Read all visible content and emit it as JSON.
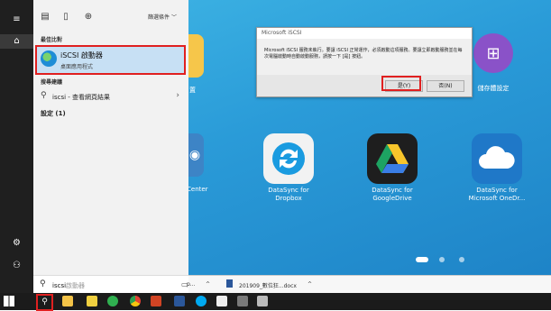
{
  "desktop": {
    "tiles": [
      {
        "label": "DataSync for\nDropbox"
      },
      {
        "label": "DataSync for\nGoogleDrive"
      },
      {
        "label": "DataSync for\nMicrosoft OneDr..."
      },
      {
        "label": "儲存體設定"
      }
    ],
    "cut_labels": {
      "top_left": "置",
      "center": "Center"
    }
  },
  "dialog": {
    "title": "Microsoft iSCSI",
    "message": "Microsoft iSCSI 服務未執行。要讓 iSCSI 正常運作，必須啟動這項服務。要讓立即啟動服務並在每次電腦啟動時自動啟動服務，請按一下 [是] 按鈕。",
    "yes": "是(Y)",
    "no": "否(N)"
  },
  "start_menu": {
    "filter": "篩選條件",
    "best_match_heading": "最佳比對",
    "best_match": {
      "name": "iSCSI 啟動器",
      "type": "桌面應用程式"
    },
    "web_heading": "搜尋建議",
    "web_suggestion": "iscsi - 查看網頁結果",
    "settings": "設定 (1)"
  },
  "search": {
    "typed": "iscsi",
    "hint": "啟動器"
  },
  "downloads": [
    {
      "name": "p..."
    },
    {
      "name": "201909_數位狂...docx"
    }
  ]
}
